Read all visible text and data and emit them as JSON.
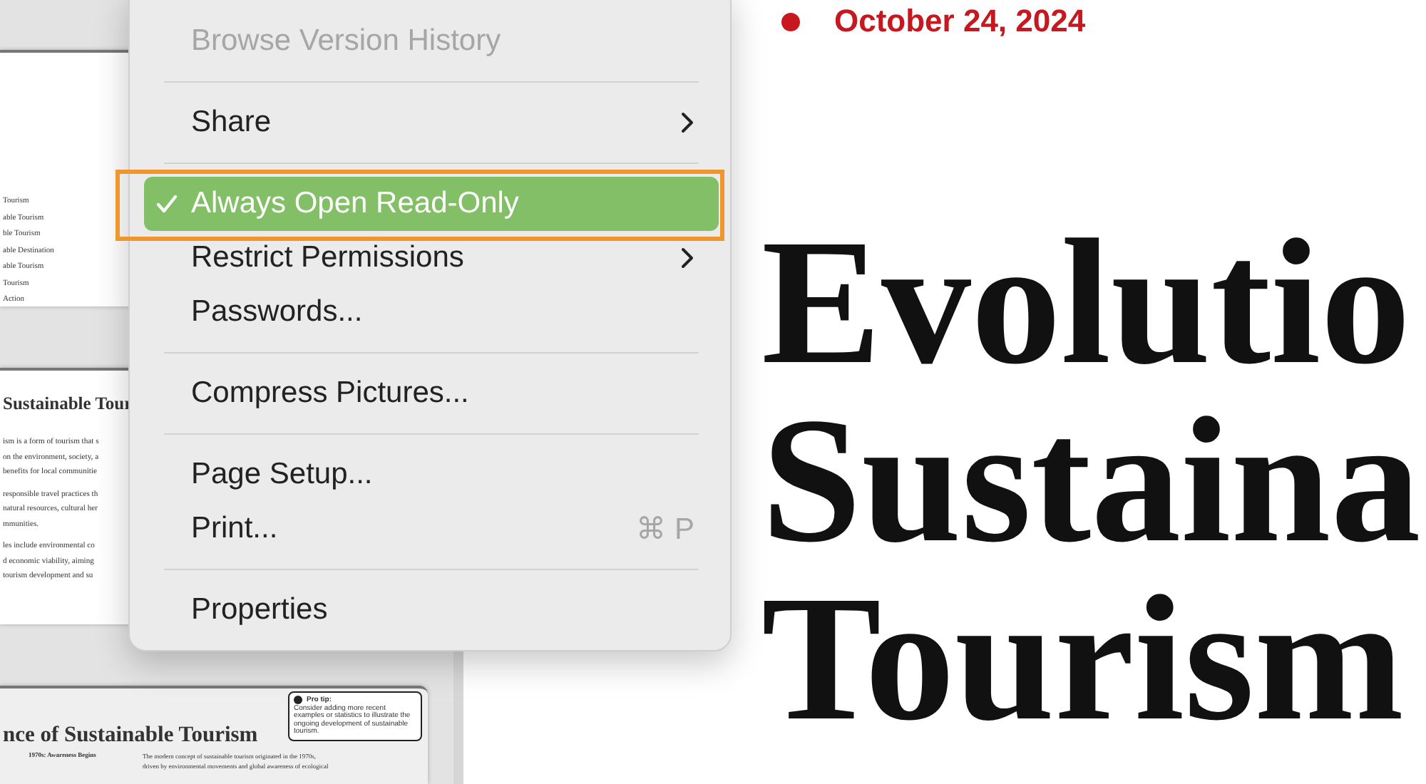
{
  "sidebar": {
    "pages": [
      {
        "kind": "toc",
        "lines": [
          "Tourism",
          "able Tourism",
          "ble Tourism",
          "able Destination",
          "able Tourism",
          "Tourism",
          "Action"
        ]
      },
      {
        "kind": "text",
        "heading": "Sustainable Tour",
        "paragraphs": [
          [
            "ism is a form of tourism that s",
            "on the environment, society, a",
            "benefits for local communitie"
          ],
          [
            "responsible travel practices th",
            "natural resources, cultural her",
            "mmunities."
          ],
          [
            "les include environmental co",
            "d economic viability, aiming",
            "tourism development and su"
          ]
        ]
      },
      {
        "kind": "timeline",
        "heading": "nce of Sustainable Tourism",
        "tip": {
          "title": "Pro tip:",
          "text": "Consider adding more recent examples or statistics to illustrate the ongoing development of sustainable tourism."
        },
        "entries": [
          {
            "label": "1970s: Awareness Begins",
            "lines": [
              "The modern concept of sustainable tourism originated in the 1970s,",
              "driven by environmental movements and global awareness of ecological"
            ]
          }
        ]
      }
    ]
  },
  "document": {
    "date": "October 24, 2024",
    "title_lines": [
      "Evolutio",
      "Sustaina",
      "Tourism"
    ]
  },
  "menu": {
    "items": [
      {
        "kind": "item",
        "label": "Browse Version History",
        "disabled": true,
        "checked": false,
        "selected": false,
        "submenu": false,
        "outlined": false
      },
      {
        "kind": "separator"
      },
      {
        "kind": "item",
        "label": "Share",
        "disabled": false,
        "checked": false,
        "selected": false,
        "submenu": true,
        "outlined": false
      },
      {
        "kind": "separator"
      },
      {
        "kind": "item",
        "label": "Always Open Read-Only",
        "disabled": false,
        "checked": true,
        "selected": true,
        "submenu": false,
        "outlined": true
      },
      {
        "kind": "item",
        "label": "Restrict Permissions",
        "disabled": false,
        "checked": false,
        "selected": false,
        "submenu": true,
        "outlined": false
      },
      {
        "kind": "item",
        "label": "Passwords...",
        "disabled": false,
        "checked": false,
        "selected": false,
        "submenu": false,
        "outlined": false
      },
      {
        "kind": "separator"
      },
      {
        "kind": "item",
        "label": "Compress Pictures...",
        "disabled": false,
        "checked": false,
        "selected": false,
        "submenu": false,
        "outlined": false
      },
      {
        "kind": "separator"
      },
      {
        "kind": "item",
        "label": "Page Setup...",
        "disabled": false,
        "checked": false,
        "selected": false,
        "submenu": false,
        "outlined": false
      },
      {
        "kind": "item",
        "label": "Print...",
        "shortcut": "⌘ P",
        "disabled": false,
        "checked": false,
        "selected": false,
        "submenu": false,
        "outlined": false
      },
      {
        "kind": "separator"
      },
      {
        "kind": "item",
        "label": "Properties",
        "disabled": false,
        "checked": false,
        "selected": false,
        "submenu": false,
        "outlined": false
      }
    ]
  }
}
